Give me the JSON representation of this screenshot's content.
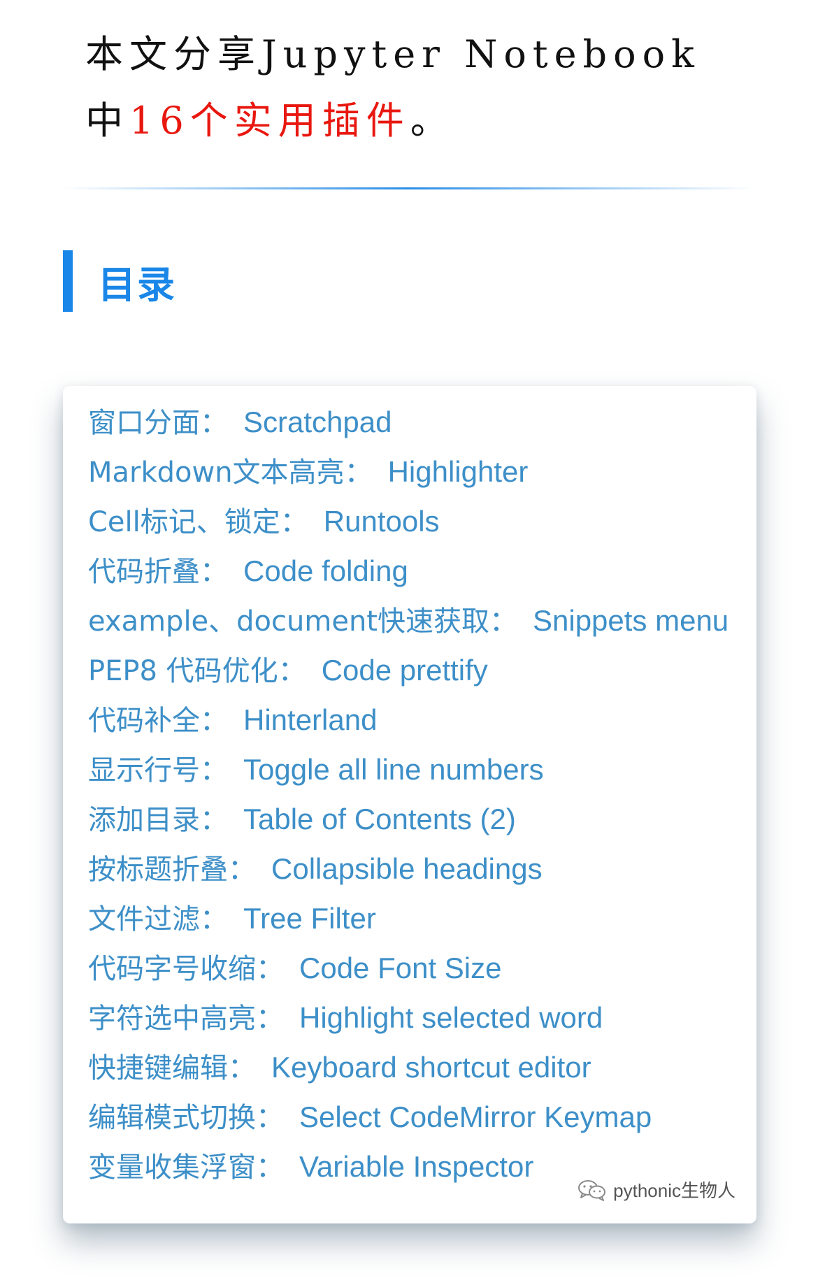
{
  "intro": {
    "line1": "本文分享Jupyter Notebook",
    "line2_prefix": "中",
    "line2_highlight": "16个实用插件",
    "line2_suffix": "。"
  },
  "colors": {
    "highlight": "#e8170f",
    "accent": "#1a87e8",
    "link": "#3d8fc8"
  },
  "section": {
    "title": "目录"
  },
  "toc": [
    {
      "zh": "窗口分面",
      "en": "Scratchpad"
    },
    {
      "zh": "Markdown文本高亮",
      "en": "Highlighter"
    },
    {
      "zh": "Cell标记、锁定",
      "en": "Runtools"
    },
    {
      "zh": "代码折叠",
      "en": "Code folding"
    },
    {
      "zh": "example、document快速获取",
      "en": "Snippets menu"
    },
    {
      "zh": "PEP8 代码优化",
      "en": "Code prettify"
    },
    {
      "zh": "代码补全",
      "en": "Hinterland"
    },
    {
      "zh": "显示行号",
      "en": "Toggle all line numbers"
    },
    {
      "zh": "添加目录",
      "en": "Table of Contents (2)"
    },
    {
      "zh": "按标题折叠",
      "en": "Collapsible headings"
    },
    {
      "zh": "文件过滤",
      "en": "Tree Filter"
    },
    {
      "zh": "代码字号收缩",
      "en": "Code Font Size"
    },
    {
      "zh": "字符选中高亮",
      "en": "Highlight selected word"
    },
    {
      "zh": "快捷键编辑",
      "en": "Keyboard shortcut editor"
    },
    {
      "zh": "编辑模式切换",
      "en": "Select CodeMirror Keymap"
    },
    {
      "zh": "变量收集浮窗",
      "en": "Variable Inspector"
    }
  ],
  "separator": "：",
  "watermark": {
    "icon": "wechat-icon",
    "text": "pythonic生物人"
  }
}
